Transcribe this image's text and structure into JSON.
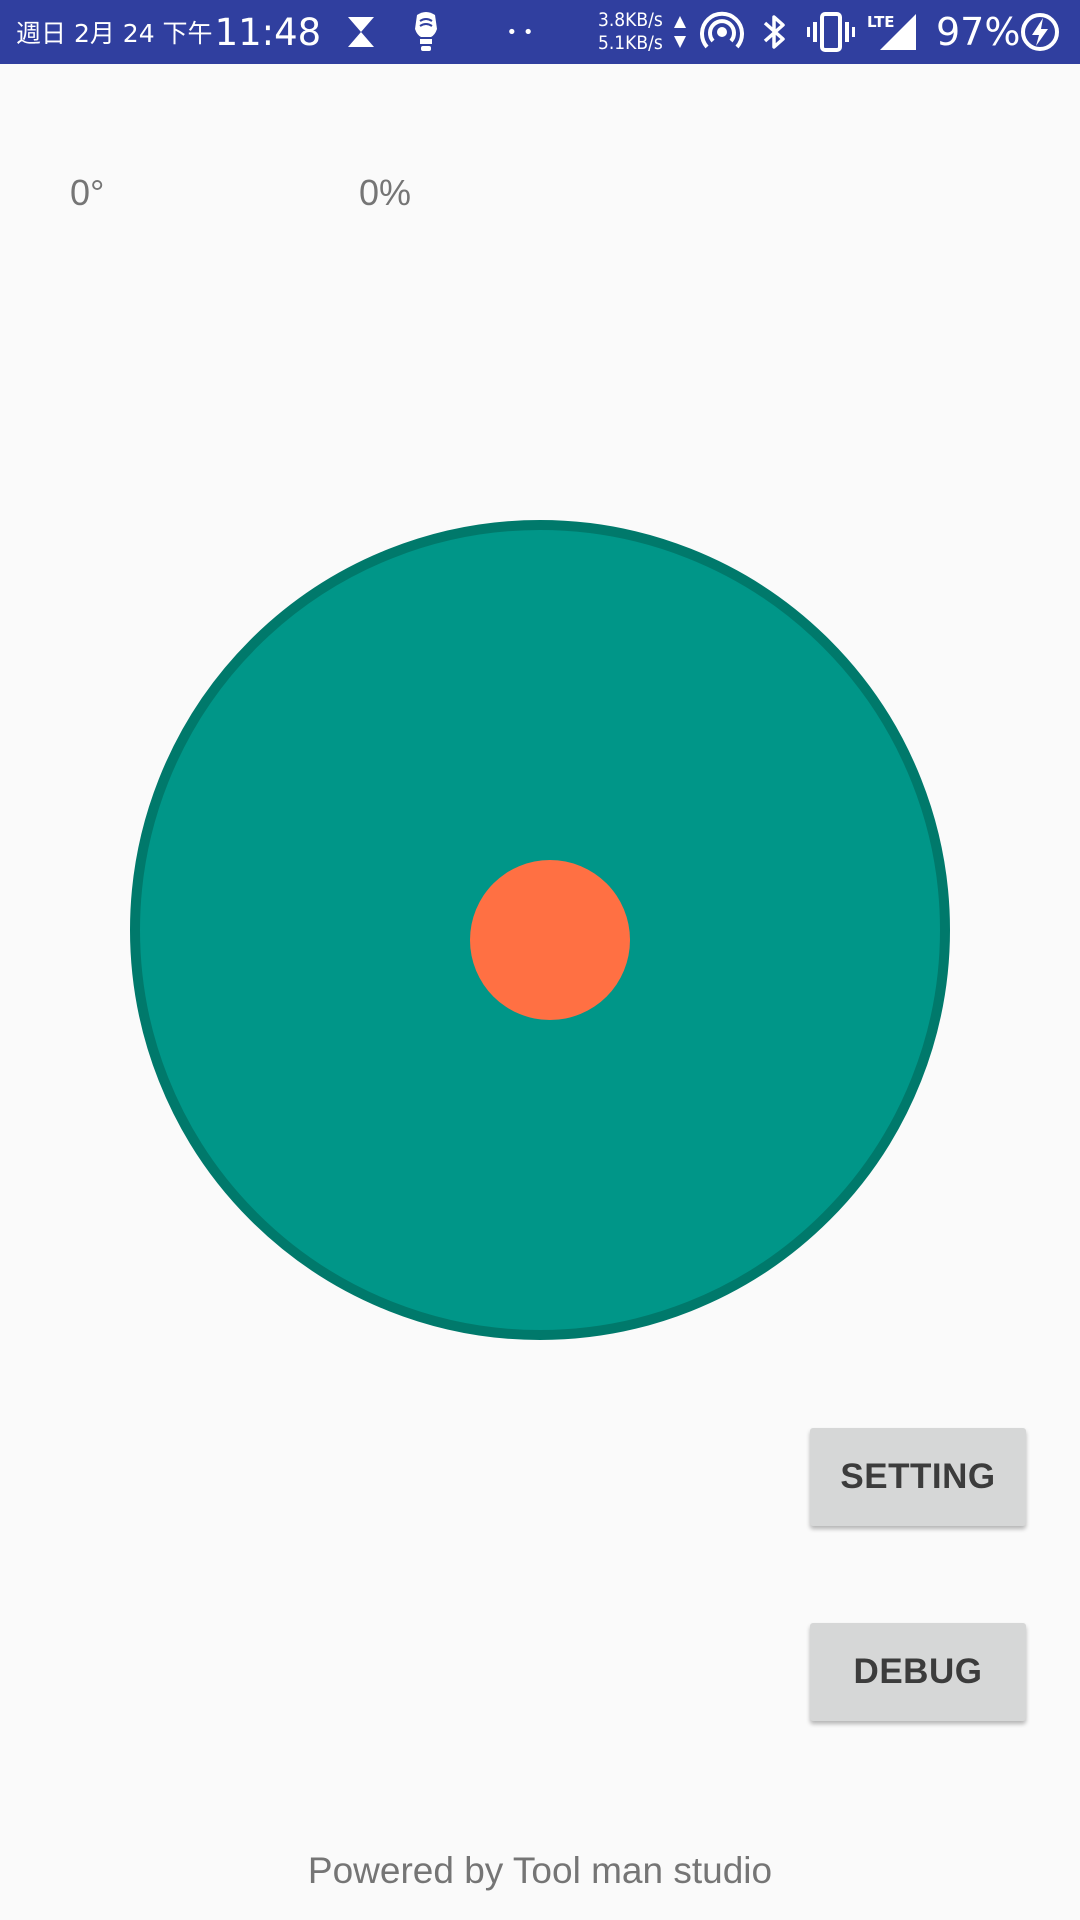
{
  "status_bar": {
    "date": "週日 2月 24 下午",
    "time": "11:48",
    "dots": "• •",
    "upload_speed": "3.8KB/s",
    "download_speed": "5.1KB/s",
    "network_type": "LTE",
    "battery": "97%",
    "icons": [
      "hourglass-icon",
      "lightbulb-fist-icon",
      "hotspot-icon",
      "bluetooth-icon",
      "vibrate-icon",
      "signal-icon",
      "battery-charging-icon"
    ],
    "background": "#303f9f"
  },
  "readouts": {
    "angle": "0°",
    "power": "0%"
  },
  "joystick": {
    "base_color": "#009688",
    "border_color": "#00796b",
    "knob_color": "#ff7043"
  },
  "buttons": {
    "setting": "SETTING",
    "debug": "DEBUG"
  },
  "footer": "Powered by Tool man studio"
}
